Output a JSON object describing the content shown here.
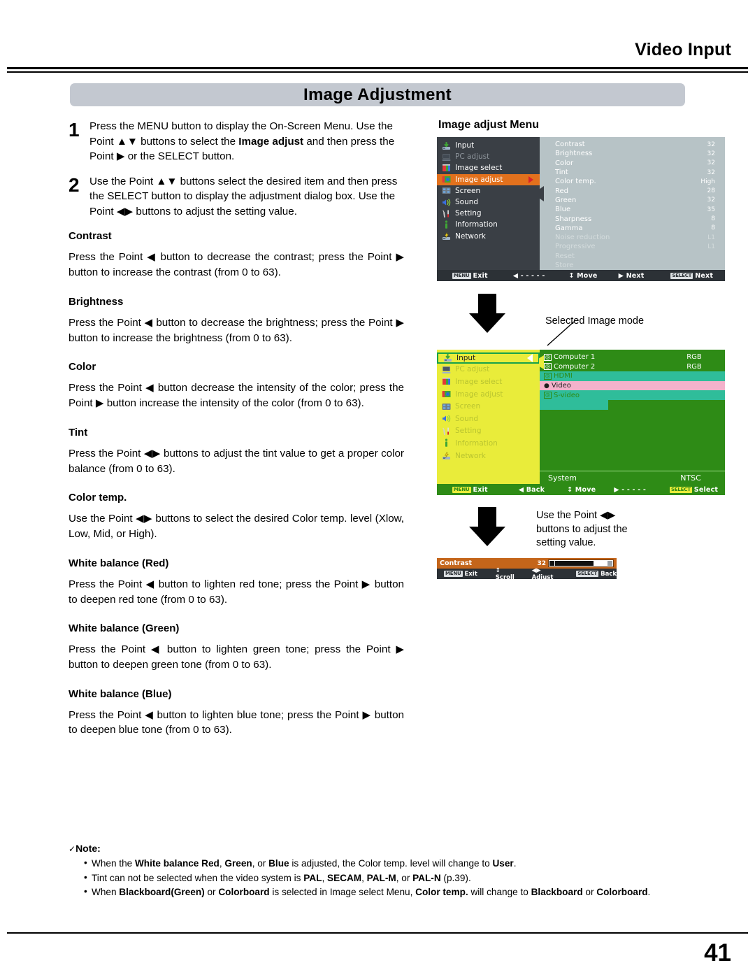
{
  "header": {
    "running_title": "Video Input",
    "banner": "Image Adjustment"
  },
  "footer": {
    "page_number": "41"
  },
  "steps": [
    {
      "num": "1",
      "html": "Press the MENU button to display the On-Screen Menu. Use the Point ▲▼ buttons to select the <b>Image adjust</b> and then press the Point ▶ or the SELECT button."
    },
    {
      "num": "2",
      "html": "Use the Point ▲▼ buttons select the desired item and then press the SELECT button to display the adjustment dialog box. Use the Point ◀▶ buttons to adjust the setting value."
    }
  ],
  "sections": [
    {
      "heading": "Contrast",
      "text": "Press the Point ◀ button to decrease the contrast; press the Point ▶ button to increase the contrast (from 0 to 63)."
    },
    {
      "heading": "Brightness",
      "text": "Press the Point ◀ button to decrease the brightness; press the Point ▶ button to increase the brightness (from 0 to 63)."
    },
    {
      "heading": "Color",
      "text": "Press the Point ◀ button decrease the intensity of the color; press the Point ▶ button increase the intensity of the color (from 0 to 63)."
    },
    {
      "heading": "Tint",
      "text": "Press the Point ◀▶ buttons to adjust the tint value to get a proper color balance (from 0 to 63)."
    },
    {
      "heading": "Color temp.",
      "text": "Use the Point ◀▶ buttons to select the desired Color temp. level (Xlow, Low, Mid, or High)."
    },
    {
      "heading": "White balance (Red)",
      "text": "Press the Point ◀ button to lighten red tone; press the Point ▶ button to deepen red tone (from 0 to 63)."
    },
    {
      "heading": "White balance (Green)",
      "text": "Press the Point ◀ button to lighten green tone; press the Point ▶ button to deepen green tone (from 0 to 63)."
    },
    {
      "heading": "White balance (Blue)",
      "text": "Press the Point ◀ button to lighten blue tone; press the Point ▶ button to deepen blue tone (from 0 to 63)."
    }
  ],
  "note": {
    "label": "Note:",
    "check": "✓",
    "items": [
      "When the <b>White balance Red</b>, <b>Green</b>, or <b>Blue</b> is adjusted, the Color temp. level will change to <b>User</b>.",
      "Tint can not be selected when the video system is <b>PAL</b>, <b>SECAM</b>, <b>PAL-M</b>, or <b>PAL-N</b> (p.39).",
      "When <b>Blackboard(Green)</b> or <b>Colorboard</b> is selected in Image select Menu, <b>Color temp.</b> will change to <b>Blackboard</b> or <b>Colorboard</b>."
    ]
  },
  "right": {
    "heading": "Image adjust Menu",
    "callout_image_mode": "Selected Image mode",
    "callout_adjust": "Use the Point ◀▶ buttons to adjust the setting value."
  },
  "osd1": {
    "sidebar": [
      {
        "label": "Input",
        "icon": "input-icon",
        "state": "normal"
      },
      {
        "label": "PC adjust",
        "icon": "pc-adjust-icon",
        "state": "dim"
      },
      {
        "label": "Image select",
        "icon": "image-select-icon",
        "state": "normal"
      },
      {
        "label": "Image adjust",
        "icon": "image-adjust-icon",
        "state": "selected"
      },
      {
        "label": "Screen",
        "icon": "screen-icon",
        "state": "normal"
      },
      {
        "label": "Sound",
        "icon": "sound-icon",
        "state": "normal"
      },
      {
        "label": "Setting",
        "icon": "setting-icon",
        "state": "normal"
      },
      {
        "label": "Information",
        "icon": "information-icon",
        "state": "normal"
      },
      {
        "label": "Network",
        "icon": "network-icon",
        "state": "normal"
      }
    ],
    "items": [
      {
        "label": "Contrast",
        "value": "32"
      },
      {
        "label": "Brightness",
        "value": "32"
      },
      {
        "label": "Color",
        "value": "32"
      },
      {
        "label": "Tint",
        "value": "32"
      },
      {
        "label": "Color temp.",
        "value": "High"
      },
      {
        "label": "Red",
        "value": "28"
      },
      {
        "label": "Green",
        "value": "32"
      },
      {
        "label": "Blue",
        "value": "35"
      },
      {
        "label": "Sharpness",
        "value": "8"
      },
      {
        "label": "Gamma",
        "value": "8"
      },
      {
        "label": "Noise reduction",
        "value": "L1"
      },
      {
        "label": "Progressive",
        "value": "L1"
      },
      {
        "label": "Reset",
        "value": ""
      },
      {
        "label": "Store",
        "value": ""
      }
    ],
    "statusbar": [
      {
        "key": "MENU",
        "label": "Exit"
      },
      {
        "key": "",
        "label": "◀ - - - - -"
      },
      {
        "key": "",
        "label": "↕ Move"
      },
      {
        "key": "",
        "label": "▶ Next"
      },
      {
        "key": "SELECT",
        "label": "Next"
      }
    ]
  },
  "osd2": {
    "sidebar": [
      {
        "label": "Input",
        "icon": "input-icon",
        "state": "selected"
      },
      {
        "label": "PC adjust",
        "icon": "pc-adjust-icon",
        "state": "normal"
      },
      {
        "label": "Image select",
        "icon": "image-select-icon",
        "state": "normal"
      },
      {
        "label": "Image adjust",
        "icon": "image-adjust-icon",
        "state": "normal"
      },
      {
        "label": "Screen",
        "icon": "screen-icon",
        "state": "normal"
      },
      {
        "label": "Sound",
        "icon": "sound-icon",
        "state": "normal"
      },
      {
        "label": "Setting",
        "icon": "setting-icon",
        "state": "normal"
      },
      {
        "label": "Information",
        "icon": "information-icon",
        "state": "normal"
      },
      {
        "label": "Network",
        "icon": "network-icon",
        "state": "normal"
      }
    ],
    "items": [
      {
        "label": "Computer 1",
        "value": "RGB",
        "state": "normal"
      },
      {
        "label": "Computer 2",
        "value": "RGB",
        "state": "normal"
      },
      {
        "label": "HDMI",
        "value": "",
        "state": "teal"
      },
      {
        "label": "Video",
        "value": "",
        "state": "highlight"
      },
      {
        "label": "S-video",
        "value": "",
        "state": "teal"
      }
    ],
    "system": {
      "label": "System",
      "value": "NTSC"
    },
    "statusbar": [
      {
        "key": "MENU",
        "label": "Exit"
      },
      {
        "key": "",
        "label": "◀ Back"
      },
      {
        "key": "",
        "label": "↕ Move"
      },
      {
        "key": "",
        "label": "▶ - - - - -"
      },
      {
        "key": "SELECT",
        "label": "Select"
      }
    ]
  },
  "dialog": {
    "label": "Contrast",
    "value": "32",
    "statusbar": [
      {
        "key": "MENU",
        "label": "Exit"
      },
      {
        "key": "",
        "label": "↕ Scroll"
      },
      {
        "key": "",
        "label": "◀▶ Adjust"
      },
      {
        "key": "SELECT",
        "label": "Back"
      }
    ]
  }
}
